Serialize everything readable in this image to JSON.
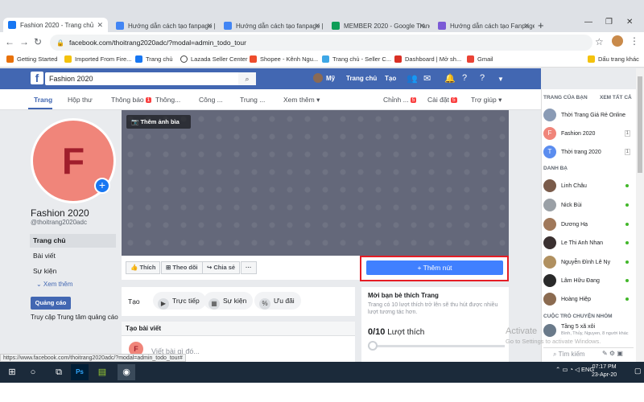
{
  "browser": {
    "tabs": [
      {
        "title": "Fashion 2020 - Trang chủ",
        "color": "#1877f2"
      },
      {
        "title": "Hướng dẫn cách tạo fanpage |",
        "color": "#4285f4"
      },
      {
        "title": "Hướng dẫn cách tạo fanpage |",
        "color": "#4285f4"
      },
      {
        "title": "MEMBER 2020 - Google Trang",
        "color": "#0f9d58"
      },
      {
        "title": "Hướng dẫn cách tạo Fanpage",
        "color": "#7b5ad6"
      }
    ],
    "new_tab": "+",
    "url": "facebook.com/thoitrang2020adc/?modal=admin_todo_tour",
    "bookmarks": [
      "Getting Started",
      "Imported From Fire...",
      "Trang chủ",
      "Lazada Seller Center",
      "Shopee - Kênh Ngu...",
      "Trang chủ - Seller C...",
      "Dashboard | Mở sh...",
      "Gmail",
      "Dấu trang khác"
    ],
    "status_url": "https://www.facebook.com/thoitrang2020adc/?modal=admin_todo_tour#"
  },
  "fb_header": {
    "search_value": "Fashion 2020",
    "user": "Mỹ",
    "home": "Trang chủ",
    "create": "Tạo"
  },
  "page_nav": {
    "items": [
      "Trang",
      "Hộp thư",
      "Thông báo",
      "Thông...",
      "Công ...",
      "Trung ...",
      "Xem thêm ▾"
    ],
    "notif_badge": "1",
    "right": [
      "Chỉnh ...",
      "Cài đặt",
      "Trợ giúp ▾"
    ],
    "edit_badge": "5",
    "settings_badge": "5"
  },
  "left": {
    "avatar_letter": "F",
    "page_name": "Fashion 2020",
    "handle": "@thoitrang2020adc",
    "menu": [
      "Trang chủ",
      "Bài viết",
      "Sự kiện"
    ],
    "see_more": "⌄ Xem thêm",
    "ads_button": "Quảng cáo",
    "access_text": "Truy cập Trung tâm quảng cáo"
  },
  "cover": {
    "add_cover": "Thêm ảnh bìa",
    "actions": [
      "Thích",
      "Theo dõi",
      "Chia sẻ",
      "···"
    ],
    "add_button": "+ Thêm nút"
  },
  "create_box": {
    "label": "Tạo",
    "pills": [
      "Trực tiếp",
      "Sự kiện",
      "Ưu đãi"
    ]
  },
  "post_box": {
    "title": "Tạo bài viết",
    "placeholder": "Viết bài gì đó..."
  },
  "invite": {
    "title": "Mời bạn bè thích Trang",
    "desc": "Trang có 10 lượt thích trở lên sẽ thu hút được nhiều lượt tương tác hơn.",
    "count": "0/10",
    "count_label": "Lượt thích",
    "progress": 0
  },
  "sidebar": {
    "your_pages": "TRANG CỦA BẠN",
    "see_all": "XEM TẤT CẢ",
    "pages": [
      {
        "name": "Thời Trang Giá Rẻ Online",
        "letter": "",
        "color": "#8a9bb5",
        "count": ""
      },
      {
        "name": "Fashion 2020",
        "letter": "F",
        "color": "#f0857a",
        "count": "1"
      },
      {
        "name": "Thời trang 2020",
        "letter": "T",
        "color": "#5b8def",
        "count": "1"
      }
    ],
    "contacts_title": "DANH BẠ",
    "contacts": [
      "Linh Châu",
      "Nick Bùi",
      "Dương Hạ",
      "Le Thi Anh Nhan",
      "Nguyễn Đình Lê Ny",
      "Lâm Hữu Đang",
      "Hoàng Hiệp"
    ],
    "chats_title": "CUỘC TRÒ CHUYỆN NHÓM",
    "group_name": "Tầng 5 xã xôi",
    "group_sub": "Bình, Thủy, Nguyen, 8 người khác",
    "search": "Tìm kiếm"
  },
  "watermark": {
    "line1": "Activate",
    "line2": "Go to Settings to activate Windows."
  },
  "taskbar": {
    "lang": "ENG",
    "time": "07:17 PM",
    "date": "23-Apr-20"
  }
}
